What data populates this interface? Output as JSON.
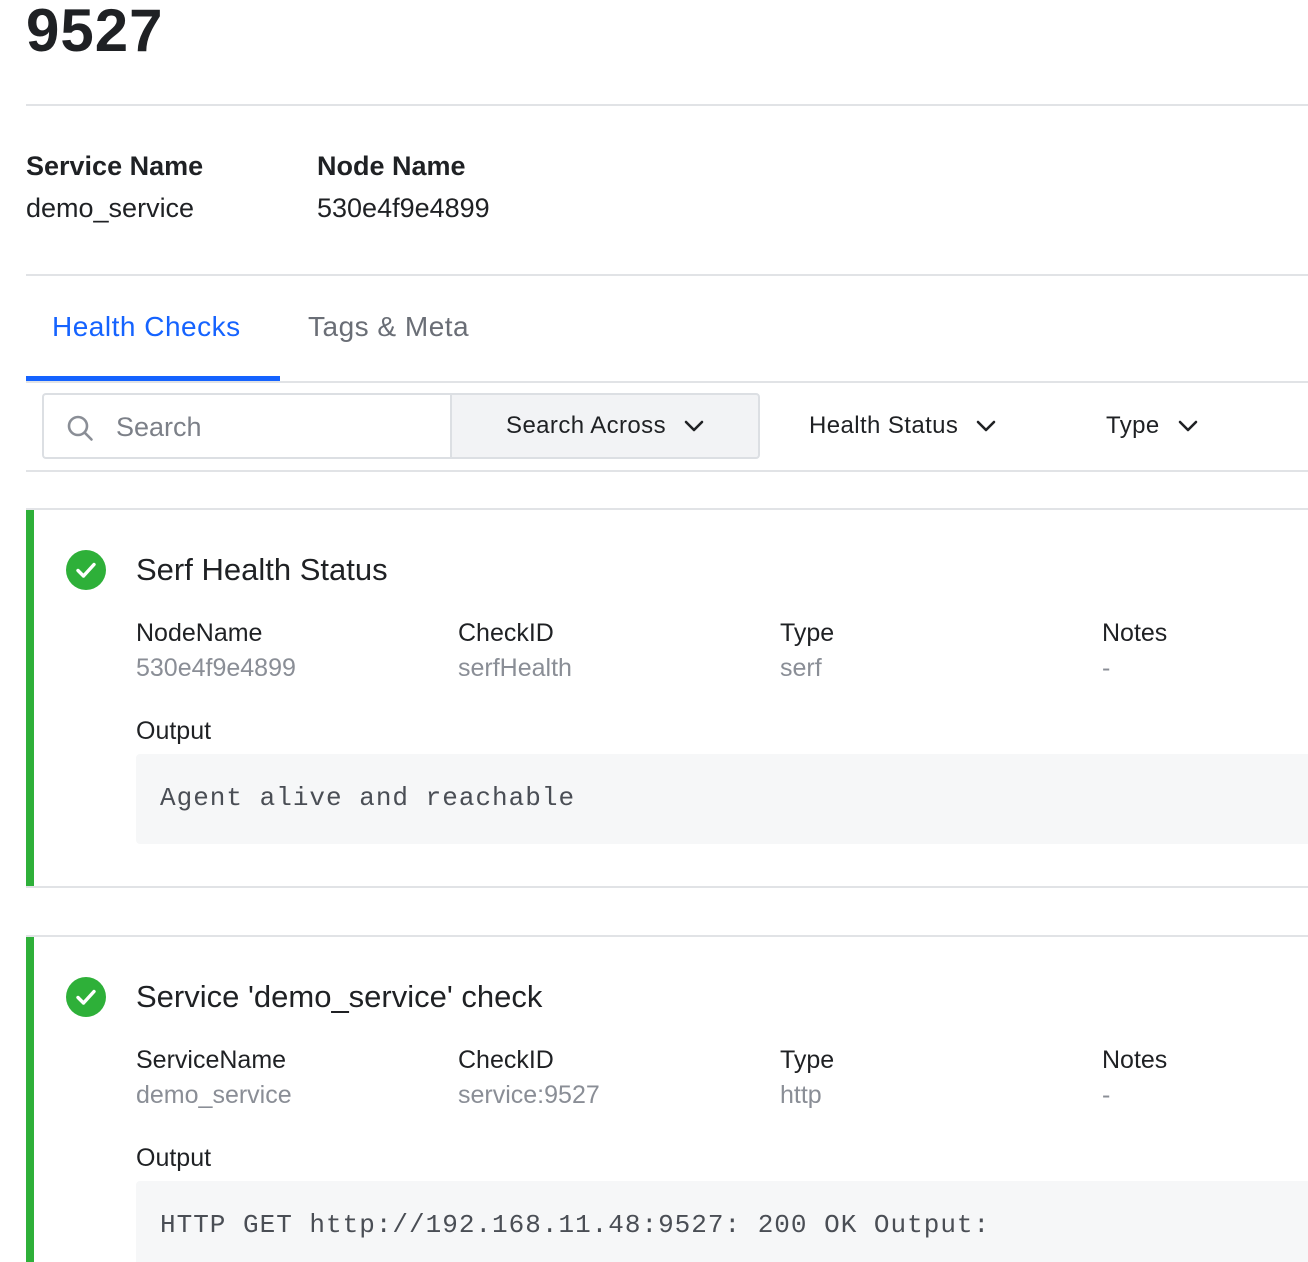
{
  "page": {
    "title": "9527"
  },
  "summary": {
    "service_label": "Service Name",
    "service_value": "demo_service",
    "node_label": "Node Name",
    "node_value": "530e4f9e4899"
  },
  "tabs": [
    {
      "label": "Health Checks",
      "active": true
    },
    {
      "label": "Tags & Meta",
      "active": false
    }
  ],
  "toolbar": {
    "search_placeholder": "Search",
    "search_across_label": "Search Across",
    "health_status_label": "Health Status",
    "type_label": "Type"
  },
  "colors": {
    "accent": "#1563ff",
    "passing": "#2eb039"
  },
  "checks": [
    {
      "status": "passing",
      "status_icon": "check-circle-icon",
      "title": "Serf Health Status",
      "fields": [
        {
          "label": "NodeName",
          "value": "530e4f9e4899"
        },
        {
          "label": "CheckID",
          "value": "serfHealth"
        },
        {
          "label": "Type",
          "value": "serf"
        },
        {
          "label": "Notes",
          "value": "-"
        }
      ],
      "output_label": "Output",
      "output": "Agent alive and reachable"
    },
    {
      "status": "passing",
      "status_icon": "check-circle-icon",
      "title": "Service 'demo_service' check",
      "fields": [
        {
          "label": "ServiceName",
          "value": "demo_service"
        },
        {
          "label": "CheckID",
          "value": "service:9527"
        },
        {
          "label": "Type",
          "value": "http"
        },
        {
          "label": "Notes",
          "value": "-"
        }
      ],
      "output_label": "Output",
      "output": "HTTP GET http://192.168.11.48:9527: 200 OK Output:"
    }
  ]
}
